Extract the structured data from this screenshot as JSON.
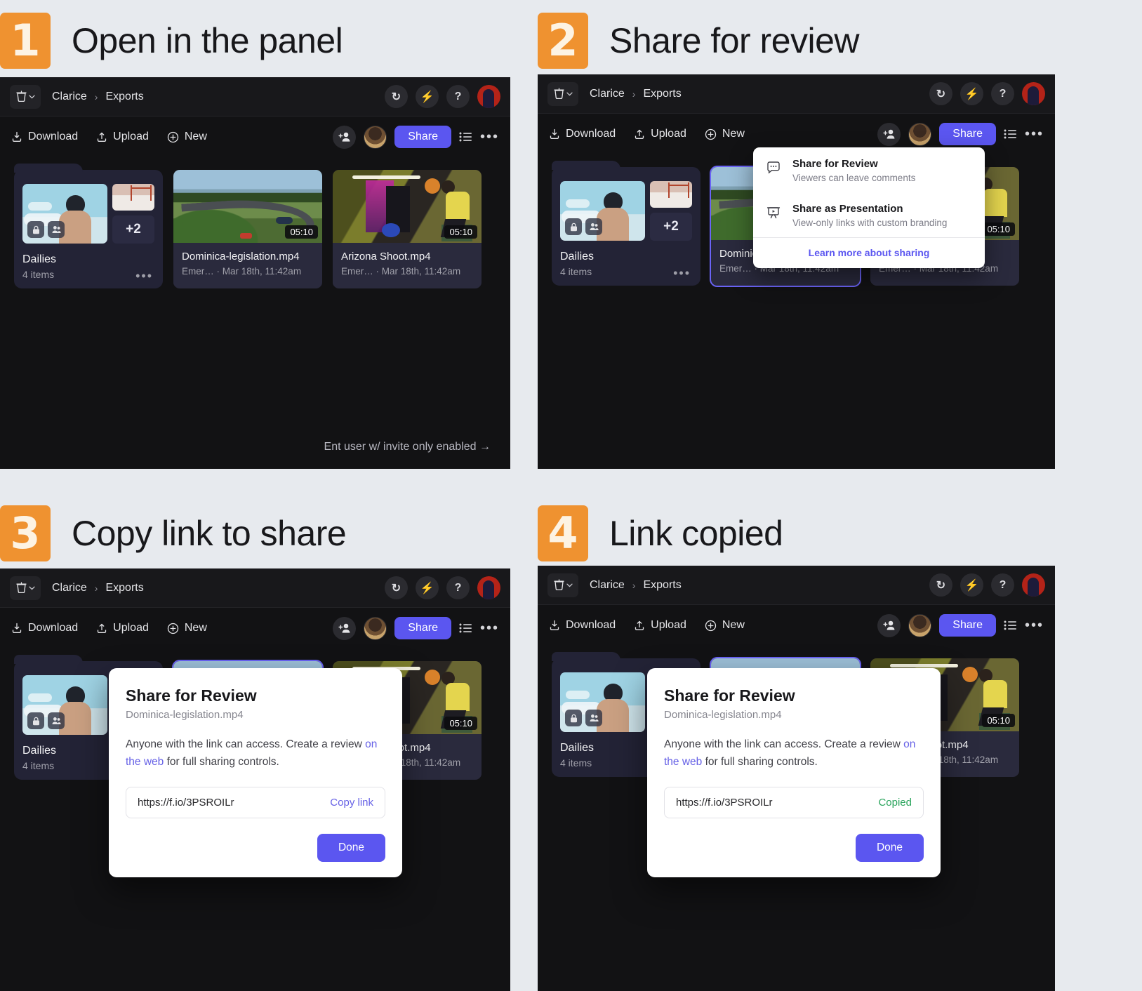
{
  "panels": [
    {
      "number": "1",
      "title": "Open in the panel"
    },
    {
      "number": "2",
      "title": "Share for review"
    },
    {
      "number": "3",
      "title": "Copy link to share"
    },
    {
      "number": "4",
      "title": "Link copied"
    }
  ],
  "app": {
    "breadcrumb": {
      "root": "Clarice",
      "separator": "›",
      "current": "Exports"
    },
    "titlebar_icons": [
      {
        "name": "refresh-icon",
        "glyph": "↻"
      },
      {
        "name": "lightning-icon",
        "glyph": "⚡"
      },
      {
        "name": "help-icon",
        "glyph": "?"
      }
    ],
    "toolbar": {
      "download_label": "Download",
      "upload_label": "Upload",
      "new_label": "New",
      "share_label": "Share"
    },
    "cards": {
      "folder": {
        "title": "Dailies",
        "subtitle": "4 items",
        "overflow_count": "+2",
        "menu_glyph": "•••"
      },
      "videos": [
        {
          "title": "Dominica-legislation.mp4",
          "subtitle": "Emer… · Mar 18th, 11:42am",
          "duration": "05:10"
        },
        {
          "title": "Arizona Shoot.mp4",
          "subtitle": "Emer… · Mar 18th, 11:42am",
          "duration": "05:10"
        }
      ]
    },
    "hint": "Ent user w/ invite only enabled →"
  },
  "dropdown": {
    "items": [
      {
        "icon": "comment-bubble-icon",
        "title": "Share for Review",
        "subtitle": "Viewers can leave comments"
      },
      {
        "icon": "presentation-icon",
        "title": "Share as Presentation",
        "subtitle": "View-only links with custom branding"
      }
    ],
    "learn_more": "Learn more about sharing"
  },
  "modal": {
    "title": "Share for Review",
    "filename": "Dominica-legislation.mp4",
    "body_part1": "Anyone with the link can access. Create a review ",
    "body_link": "on the web",
    "body_part2": " for full sharing controls.",
    "url": "https://f.io/3PSROILr",
    "copy_label": "Copy link",
    "copied_label": "Copied",
    "done_label": "Done"
  },
  "colors": {
    "badge_orange": "#ef9230",
    "accent_purple": "#5b56f0",
    "copied_green": "#2aa45c",
    "page_background": "#e7eaee",
    "app_background": "#121214"
  }
}
